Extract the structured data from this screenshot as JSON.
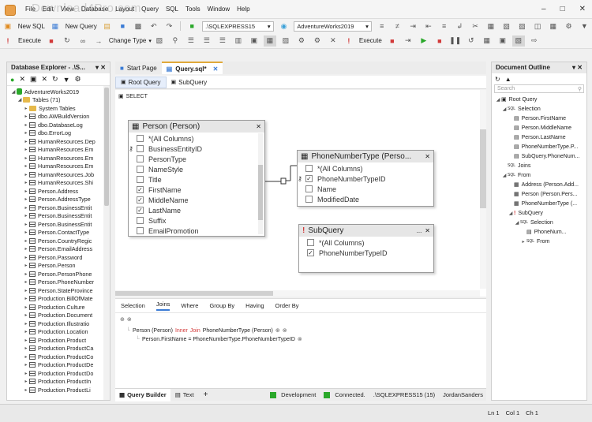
{
  "watermark": "Download4Pro.com",
  "menu": [
    "File",
    "Edit",
    "View",
    "Database",
    "Layout",
    "Query",
    "SQL",
    "Tools",
    "Window",
    "Help"
  ],
  "toolbar1": {
    "new_sql": "New SQL",
    "new_query": "New Query",
    "server": ".\\SQLEXPRESS15",
    "database": "AdventureWorks2019"
  },
  "toolbar2": {
    "execute": "Execute",
    "change_type": "Change Type",
    "execute2": "Execute"
  },
  "db_explorer": {
    "title": "Database Explorer - .\\S...",
    "root": "AdventureWorks2019",
    "tables_folder": "Tables (71)",
    "items": [
      "System Tables",
      "dbo.AWBuildVersion",
      "dbo.DatabaseLog",
      "dbo.ErrorLog",
      "HumanResources.Dep",
      "HumanResources.Em",
      "HumanResources.Em",
      "HumanResources.Em",
      "HumanResources.Job",
      "HumanResources.Shi",
      "Person.Address",
      "Person.AddressType",
      "Person.BusinessEntit",
      "Person.BusinessEntit",
      "Person.BusinessEntit",
      "Person.ContactType",
      "Person.CountryRegic",
      "Person.EmailAddress",
      "Person.Password",
      "Person.Person",
      "Person.PersonPhone",
      "Person.PhoneNumber",
      "Person.StateProvince",
      "Production.BillOfMate",
      "Production.Culture",
      "Production.Document",
      "Production.Illustratio",
      "Production.Location",
      "Production.Product",
      "Production.ProductCa",
      "Production.ProductCo",
      "Production.ProductDe",
      "Production.ProductDo",
      "Production.ProductIn",
      "Production.ProductLi"
    ]
  },
  "doc_tabs": {
    "start_page": "Start Page",
    "query": "Query.sql*"
  },
  "subtabs": {
    "root_query": "Root Query",
    "sub_query": "SubQuery"
  },
  "select_label": "SELECT",
  "person_table": {
    "title": "Person (Person)",
    "columns": [
      {
        "label": "*(All Columns)",
        "checked": false,
        "key": false
      },
      {
        "label": "BusinessEntityID",
        "checked": false,
        "key": true
      },
      {
        "label": "PersonType",
        "checked": false,
        "key": false
      },
      {
        "label": "NameStyle",
        "checked": false,
        "key": false
      },
      {
        "label": "Title",
        "checked": false,
        "key": false
      },
      {
        "label": "FirstName",
        "checked": true,
        "key": false
      },
      {
        "label": "MiddleName",
        "checked": true,
        "key": false
      },
      {
        "label": "LastName",
        "checked": true,
        "key": false
      },
      {
        "label": "Suffix",
        "checked": false,
        "key": false
      },
      {
        "label": "EmailPromotion",
        "checked": false,
        "key": false
      }
    ]
  },
  "phone_table": {
    "title": "PhoneNumberType  (Perso...",
    "columns": [
      {
        "label": "*(All Columns)",
        "checked": false,
        "key": false
      },
      {
        "label": "PhoneNumberTypeID",
        "checked": true,
        "key": true
      },
      {
        "label": "Name",
        "checked": false,
        "key": false
      },
      {
        "label": "ModifiedDate",
        "checked": false,
        "key": false
      }
    ]
  },
  "subquery_table": {
    "title": "SubQuery",
    "columns": [
      {
        "label": "*(All Columns)",
        "checked": false,
        "key": false
      },
      {
        "label": "PhoneNumberTypeID",
        "checked": true,
        "key": false
      }
    ]
  },
  "bottom_tabs": [
    "Selection",
    "Joins",
    "Where",
    "Group By",
    "Having",
    "Order By"
  ],
  "join": {
    "left": "Person (Person)",
    "inner": "Inner",
    "join_word": "Join",
    "right": "PhoneNumberType (Person)",
    "condition": "Person.FirstName  =  PhoneNumberType.PhoneNumberTypeID"
  },
  "bottom_bar": {
    "query_builder": "Query Builder",
    "text": "Text",
    "env": "Development",
    "connected": "Connected.",
    "server": ".\\SQLEXPRESS15 (15)",
    "user": "JordanSanders"
  },
  "outline": {
    "title": "Document Outline",
    "search_placeholder": "Search",
    "root_query": "Root Query",
    "selection": "Selection",
    "fields": [
      "Person.FirstName",
      "Person.MiddleName",
      "Person.LastName",
      "PhoneNumberType.P...",
      "SubQuery.PhoneNum..."
    ],
    "joins": "Joins",
    "from": "From",
    "from_items": [
      "Address (Person.Add...",
      "Person (Person.Pers...",
      "PhoneNumberType (..."
    ],
    "subquery": "SubQuery",
    "sub_selection": "Selection",
    "sub_field": "PhoneNum...",
    "sub_from": "From"
  },
  "statusbar": {
    "ln": "Ln 1",
    "col": "Col 1",
    "ch": "Ch 1"
  },
  "colors": {
    "accent": "#3a7bd5",
    "green": "#2aa82a",
    "red": "#d23a3a"
  }
}
